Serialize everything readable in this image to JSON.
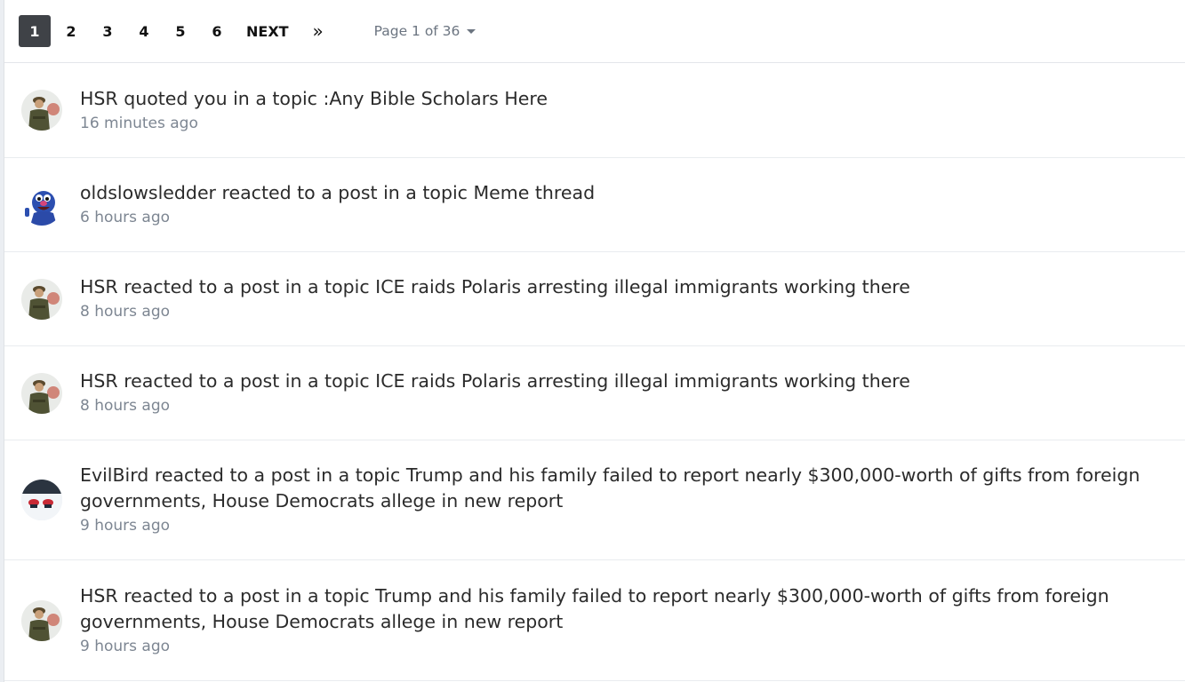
{
  "pagination": {
    "pages": [
      "1",
      "2",
      "3",
      "4",
      "5",
      "6"
    ],
    "active": "1",
    "next_label": "NEXT",
    "last_label": "»",
    "page_jump": "Page 1 of 36"
  },
  "activity": [
    {
      "user": "HSR",
      "action": "quoted you in a topic :",
      "topic": "Any Bible Scholars Here",
      "time": "16 minutes ago",
      "avatar": "soldier"
    },
    {
      "user": "oldslowsledder",
      "action": "reacted to a post in a topic",
      "topic": "Meme thread",
      "time": "6 hours ago",
      "avatar": "grover"
    },
    {
      "user": "HSR",
      "action": "reacted to a post in a topic",
      "topic": "ICE raids Polaris arresting illegal immigrants working there",
      "time": "8 hours ago",
      "avatar": "soldier"
    },
    {
      "user": "HSR",
      "action": "reacted to a post in a topic",
      "topic": "ICE raids Polaris arresting illegal immigrants working there",
      "time": "8 hours ago",
      "avatar": "soldier"
    },
    {
      "user": "EvilBird",
      "action": "reacted to a post in a topic",
      "topic": "Trump and his family failed to report nearly $300,000-worth of gifts from foreign governments, House Democrats allege in new report",
      "time": "9 hours ago",
      "avatar": "snowmobiles"
    },
    {
      "user": "HSR",
      "action": "reacted to a post in a topic",
      "topic": "Trump and his family failed to report nearly $300,000-worth of gifts from foreign governments, House Democrats allege in new report",
      "time": "9 hours ago",
      "avatar": "soldier"
    }
  ]
}
